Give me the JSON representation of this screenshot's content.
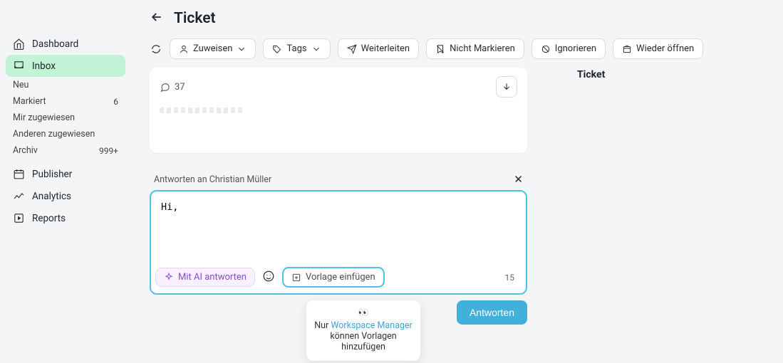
{
  "sidebar": {
    "dashboard": "Dashboard",
    "inbox": "Inbox",
    "subs": {
      "neu": "Neu",
      "markiert": "Markiert",
      "markiert_count": "6",
      "zugewiesen": "Mir zugewiesen",
      "anderen": "Anderen zugewiesen",
      "archiv": "Archiv",
      "archiv_count": "999+"
    },
    "publisher": "Publisher",
    "analytics": "Analytics",
    "reports": "Reports"
  },
  "header": {
    "title": "Ticket"
  },
  "toolbar": {
    "zuweisen": "Zuweisen",
    "tags": "Tags",
    "weiterleiten": "Weiterleiten",
    "nicht_markieren": "Nicht Markieren",
    "ignorieren": "Ignorieren",
    "wieder_oeffnen": "Wieder öffnen"
  },
  "conversation": {
    "count": "37"
  },
  "right": {
    "title": "Ticket"
  },
  "reply": {
    "head": "Antworten an Christian Müller",
    "value": "Hi,",
    "ai_btn": "Mit AI antworten",
    "template_btn": "Vorlage einfügen",
    "remaining": "15",
    "submit": "Antworten"
  },
  "popover": {
    "eyes": "👀",
    "pre": "Nur ",
    "link": "Workspace Manager",
    "post1": " können Vorlagen",
    "post2": "hinzufügen"
  }
}
